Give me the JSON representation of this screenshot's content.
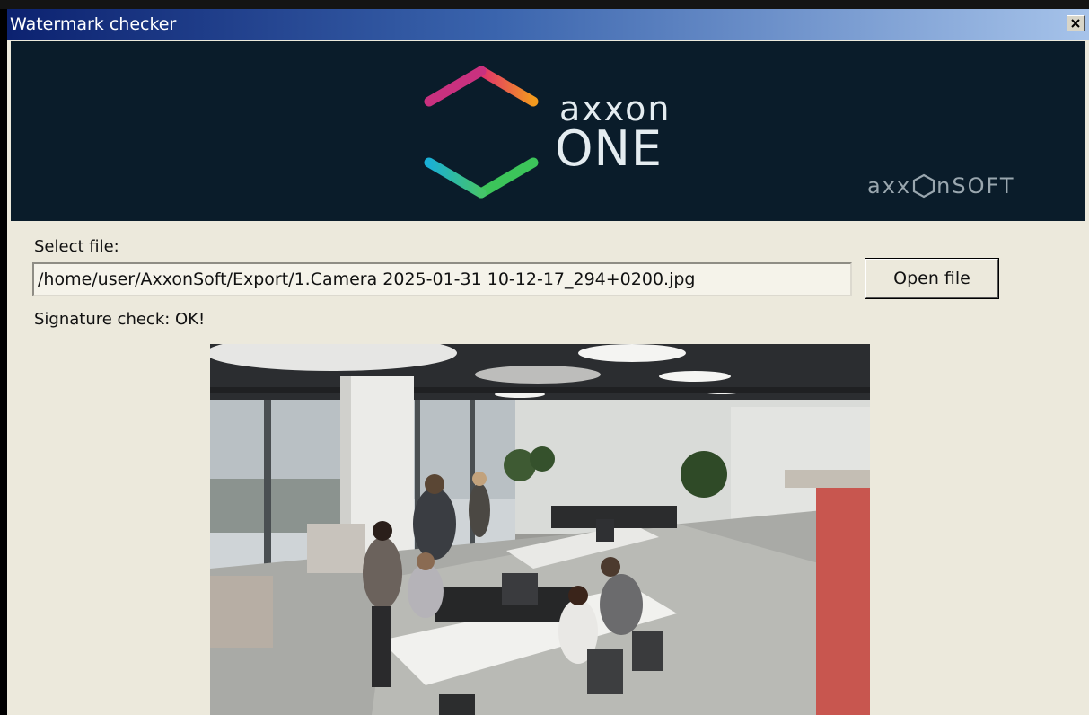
{
  "window": {
    "title": "Watermark checker",
    "close_icon": "close-icon"
  },
  "banner": {
    "logo_icon": "axxon-hexagon-logo",
    "product_line1": "axxon",
    "product_line2": "ONE",
    "company_prefix": "axx",
    "company_suffix": "nSOFT",
    "background_color": "#0a1c2a"
  },
  "file_select": {
    "label": "Select file:",
    "path_value": "/home/user/AxxonSoft/Export/1.Camera 2025-01-31 10-12-17_294+0200.jpg",
    "open_button_label": "Open file"
  },
  "status": {
    "signature_text": "Signature check: OK!"
  },
  "preview": {
    "description_icon": "camera-frame-image"
  }
}
